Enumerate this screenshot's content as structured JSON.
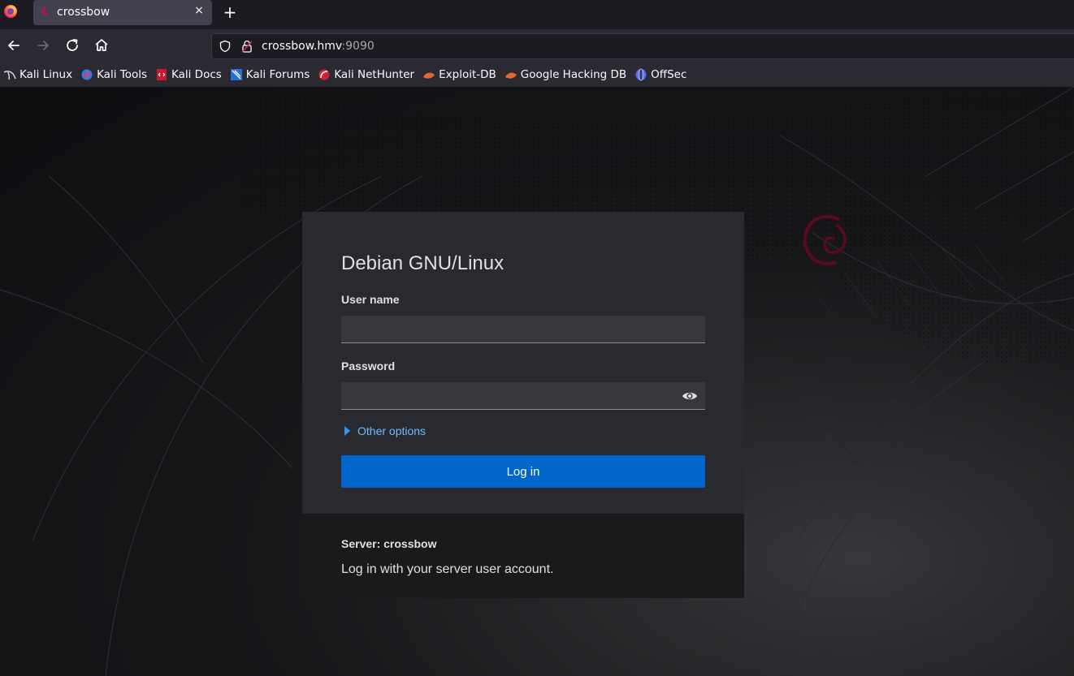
{
  "browser": {
    "tab": {
      "title": "crossbow",
      "close": "×"
    },
    "new_tab": "+",
    "url": {
      "host": "crossbow.hmv",
      "port": ":9090"
    },
    "bookmarks": [
      {
        "label": "Kali Linux",
        "icon": "kali-dragon-icon"
      },
      {
        "label": "Kali Tools",
        "icon": "kali-tools-icon"
      },
      {
        "label": "Kali Docs",
        "icon": "kali-docs-icon"
      },
      {
        "label": "Kali Forums",
        "icon": "kali-forums-icon"
      },
      {
        "label": "Kali NetHunter",
        "icon": "nethunter-icon"
      },
      {
        "label": "Exploit-DB",
        "icon": "exploitdb-icon"
      },
      {
        "label": "Google Hacking DB",
        "icon": "ghdb-icon"
      },
      {
        "label": "OffSec",
        "icon": "offsec-icon"
      }
    ]
  },
  "login": {
    "title": "Debian GNU/Linux",
    "username_label": "User name",
    "username_value": "",
    "password_label": "Password",
    "password_value": "",
    "other_options": "Other options",
    "login_button": "Log in",
    "server_label": "Server: crossbow",
    "server_hint": "Log in with your server user account."
  },
  "colors": {
    "accent": "#0066cc",
    "link": "#73bcf7",
    "debian_red": "#a80030"
  }
}
